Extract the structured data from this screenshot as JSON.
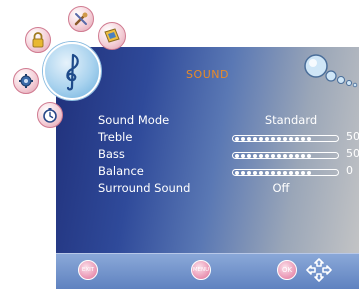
{
  "menu": {
    "title": "SOUND",
    "rows": [
      {
        "label": "Sound Mode",
        "value": "Standard"
      },
      {
        "label": "Treble",
        "level": "50"
      },
      {
        "label": "Bass",
        "level": "50"
      },
      {
        "label": "Balance",
        "level": "0"
      },
      {
        "label": "Surround Sound",
        "value": "Off"
      }
    ]
  },
  "footer": {
    "exit_label": "EXIT",
    "menu_label": "MENU",
    "ok_label": "OK"
  },
  "icons": [
    "lock-icon",
    "tools-icon",
    "picture-icon",
    "settings-icon",
    "timer-icon",
    "music-note-icon",
    "bubbles-icon",
    "direction-arrows-icon"
  ],
  "colors": {
    "title": "#e88a28",
    "panel_start": "#20307a",
    "panel_end": "#c6c6c6",
    "button": "#e07098"
  }
}
